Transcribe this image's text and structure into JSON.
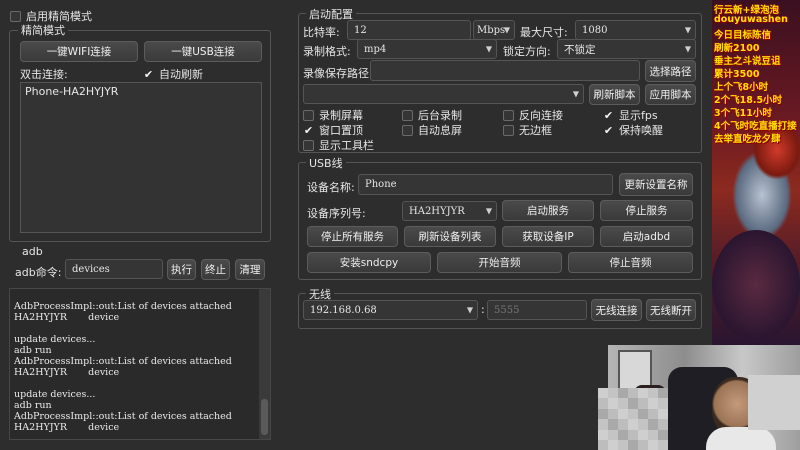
{
  "top": {
    "enable_simple_mode_label": "启用精简模式"
  },
  "simple_mode": {
    "title": "精简模式",
    "wifi_connect": "一键WIFI连接",
    "usb_connect": "一键USB连接",
    "double_click_label": "双击连接:",
    "auto_refresh_label": "自动刷新",
    "devices": [
      "Phone-HA2HYJYR"
    ]
  },
  "adb": {
    "title": "adb",
    "cmd_label": "adb命令:",
    "cmd_value": "devices",
    "execute": "执行",
    "stop": "终止",
    "clear": "清理",
    "console_lines": [
      "AdbProcessImpl::out:List of devices attached",
      "HA2HYJYR       device",
      "",
      "update devices...",
      "adb run",
      "AdbProcessImpl::out:List of devices attached",
      "HA2HYJYR       device",
      "",
      "update devices...",
      "adb run",
      "AdbProcessImpl::out:List of devices attached",
      "HA2HYJYR       device"
    ]
  },
  "start_config": {
    "title": "启动配置",
    "bitrate_label": "比特率:",
    "bitrate_value": "12",
    "bitrate_unit": "Mbps",
    "max_size_label": "最大尺寸:",
    "max_size_value": "1080",
    "record_format_label": "录制格式:",
    "record_format_value": "mp4",
    "lock_orientation_label": "锁定方向:",
    "lock_orientation_value": "不锁定",
    "record_path_label": "录像保存路径",
    "record_path_value": "",
    "choose_path": "选择路径",
    "script_value": "",
    "refresh_script": "刷新脚本",
    "apply_script": "应用脚本",
    "options": [
      {
        "label": "录制屏幕",
        "checked": false
      },
      {
        "label": "后台录制",
        "checked": false
      },
      {
        "label": "反向连接",
        "checked": false
      },
      {
        "label": "显示fps",
        "checked": true
      },
      {
        "label": "窗口置顶",
        "checked": true
      },
      {
        "label": "自动息屏",
        "checked": false
      },
      {
        "label": "无边框",
        "checked": false
      },
      {
        "label": "保持唤醒",
        "checked": true
      },
      {
        "label": "显示工具栏",
        "checked": false
      }
    ]
  },
  "usb": {
    "title": "USB线",
    "device_name_label": "设备名称:",
    "device_name_value": "Phone",
    "update_name": "更新设置名称",
    "serial_label": "设备序列号:",
    "serial_value": "HA2HYJYR",
    "start_service": "启动服务",
    "stop_service": "停止服务",
    "stop_all": "停止所有服务",
    "refresh_list": "刷新设备列表",
    "get_ip": "获取设备IP",
    "start_adbd": "启动adbd",
    "install_sndcpy": "安装sndcpy",
    "start_audio": "开始音频",
    "stop_audio": "停止音频"
  },
  "wireless": {
    "title": "无线",
    "ip_value": "192.168.0.68",
    "port_sep": ":",
    "port_placeholder": "5555",
    "connect": "无线连接",
    "disconnect": "无线断开"
  },
  "overlay": {
    "banner_lines": [
      "行云新+绿泡泡",
      "douyuwashen",
      "今日目标陈信",
      "刷新2100",
      "垂主之斗说豆诅",
      "累计3500",
      "上个飞8小时",
      "2个飞18.5小时",
      "3个飞11小时",
      "4个飞时吃直播打接",
      "去举直吃龙夕肆"
    ],
    "colors": {
      "banner_text": "#ffe100",
      "window_bg": "#2d2d2d",
      "button_bg": "#424242"
    }
  }
}
